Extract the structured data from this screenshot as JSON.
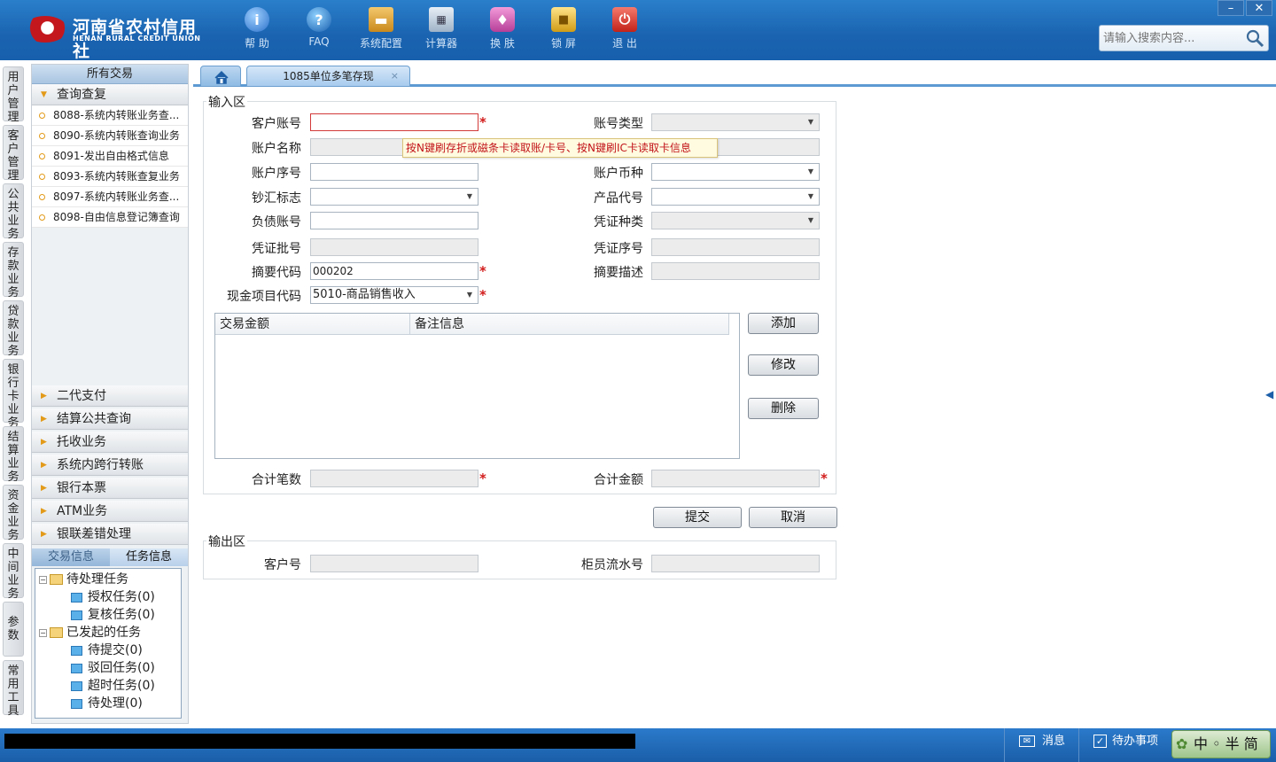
{
  "app": {
    "logo_cn": "河南省农村信用社",
    "logo_en": "HENAN RURAL CREDIT UNION"
  },
  "toolbar": [
    {
      "label": "帮 助",
      "icon": "info-icon"
    },
    {
      "label": "FAQ",
      "icon": "question-icon"
    },
    {
      "label": "系统配置",
      "icon": "toolbox-icon"
    },
    {
      "label": "计算器",
      "icon": "calculator-icon"
    },
    {
      "label": "换 肤",
      "icon": "shirt-icon"
    },
    {
      "label": "锁 屏",
      "icon": "lock-icon"
    },
    {
      "label": "退 出",
      "icon": "power-icon"
    }
  ],
  "search": {
    "placeholder": "请输入搜索内容..."
  },
  "window": {
    "minimize": "–",
    "close": "✕"
  },
  "vtabs": [
    "用户管理",
    "客户管理",
    "公共业务",
    "存款业务",
    "贷款业务",
    "银行卡业务",
    "结算业务",
    "资金业务",
    "中间业务",
    "参数",
    "常用工具"
  ],
  "left_panel": {
    "header": "所有交易",
    "open_category": "查询查复",
    "open_items": [
      "8088-系统内转账业务查...",
      "8090-系统内转账查询业务",
      "8091-发出自由格式信息",
      "8093-系统内转账查复业务",
      "8097-系统内转账业务查...",
      "8098-自由信息登记簿查询"
    ],
    "categories": [
      "二代支付",
      "结算公共查询",
      "托收业务",
      "系统内跨行转账",
      "银行本票",
      "ATM业务",
      "银联差错处理"
    ]
  },
  "task_panel": {
    "tabs": [
      "交易信息",
      "任务信息"
    ],
    "pending_group": "待处理任务",
    "pending_items": [
      "授权任务(0)",
      "复核任务(0)"
    ],
    "initiated_group": "已发起的任务",
    "initiated_items": [
      "待提交(0)",
      "驳回任务(0)",
      "超时任务(0)",
      "待处理(0)"
    ]
  },
  "tabs": {
    "active": "1085单位多笔存现",
    "close": "×"
  },
  "form": {
    "input_section": "输入区",
    "output_section": "输出区",
    "tooltip": "按N键刷存折或磁条卡读取账/卡号、按N键刷IC卡读取卡信息",
    "labels": {
      "customer_account": "客户账号",
      "account_type": "账号类型",
      "account_name": "账户名称",
      "account_seq": "账户序号",
      "currency": "账户币种",
      "cash_flag": "钞汇标志",
      "product_code": "产品代号",
      "liability_account": "负债账号",
      "voucher_type": "凭证种类",
      "voucher_batch": "凭证批号",
      "voucher_seq": "凭证序号",
      "summary_code": "摘要代码",
      "summary_desc": "摘要描述",
      "cash_item_code": "现金项目代码",
      "total_count": "合计笔数",
      "total_amount": "合计金额",
      "customer_no": "客户号",
      "teller_serial": "柜员流水号"
    },
    "values": {
      "summary_code": "000202",
      "cash_item_code": "5010-商品销售收入"
    },
    "grid_columns": [
      "交易金额",
      "备注信息"
    ],
    "buttons": {
      "add": "添加",
      "modify": "修改",
      "delete": "删除",
      "submit": "提交",
      "cancel": "取消"
    }
  },
  "status_bar": {
    "message": "消息",
    "todo": "待办事项",
    "ime": "中 ◦ 半 简"
  }
}
